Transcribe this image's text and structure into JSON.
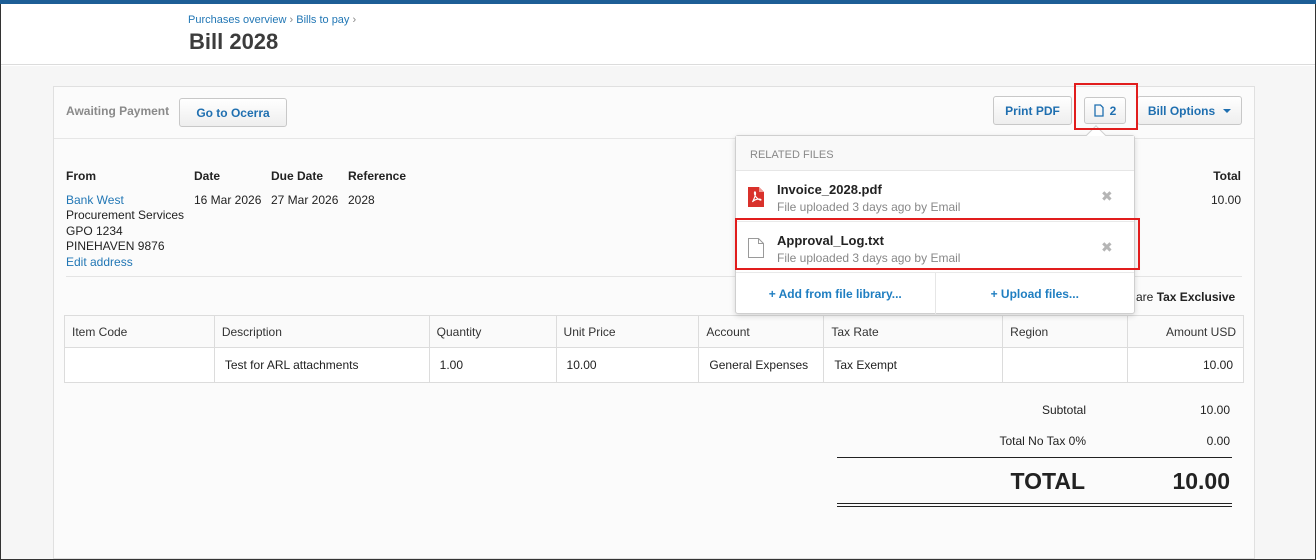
{
  "breadcrumb": {
    "items": [
      "Purchases overview",
      "Bills to pay"
    ],
    "separator": "›"
  },
  "page": {
    "title": "Bill 2028"
  },
  "toolbar": {
    "status": "Awaiting Payment",
    "go_to_ocerra": "Go to Ocerra",
    "print_pdf": "Print PDF",
    "files_count": "2",
    "bill_options": "Bill Options"
  },
  "bill": {
    "from_label": "From",
    "from_name": "Bank West",
    "from_address": [
      "Procurement Services",
      "GPO 1234",
      "PINEHAVEN 9876"
    ],
    "edit_address": "Edit address",
    "date_label": "Date",
    "date": "16 Mar 2026",
    "due_label": "Due Date",
    "due": "27 Mar 2026",
    "ref_label": "Reference",
    "ref": "2028",
    "total_label": "Total",
    "total": "10.00",
    "amounts_prefix": "are",
    "amounts_mode": "Tax Exclusive"
  },
  "table": {
    "headers": [
      "Item Code",
      "Description",
      "Quantity",
      "Unit Price",
      "Account",
      "Tax Rate",
      "Region",
      "Amount USD"
    ],
    "rows": [
      [
        "",
        "Test for ARL attachments",
        "1.00",
        "10.00",
        "General Expenses",
        "Tax Exempt",
        "",
        "10.00"
      ]
    ]
  },
  "totals": {
    "subtotal_label": "Subtotal",
    "subtotal": "10.00",
    "tax_label": "Total No Tax 0%",
    "tax": "0.00",
    "total_label": "TOTAL",
    "total": "10.00"
  },
  "files_dropdown": {
    "title": "RELATED FILES",
    "files": [
      {
        "name": "Invoice_2028.pdf",
        "meta": "File uploaded 3 days ago by Email",
        "icon": "pdf-file-icon"
      },
      {
        "name": "Approval_Log.txt",
        "meta": "File uploaded 3 days ago by Email",
        "icon": "text-file-icon"
      }
    ],
    "remove_symbol": "✖",
    "add_from_library": "+ Add from file library...",
    "upload_files": "+ Upload files..."
  },
  "colors": {
    "accent": "#1f6fb0",
    "topbar": "#1d5e96",
    "highlight": "#e11d1d",
    "pdf": "#d9312b"
  }
}
